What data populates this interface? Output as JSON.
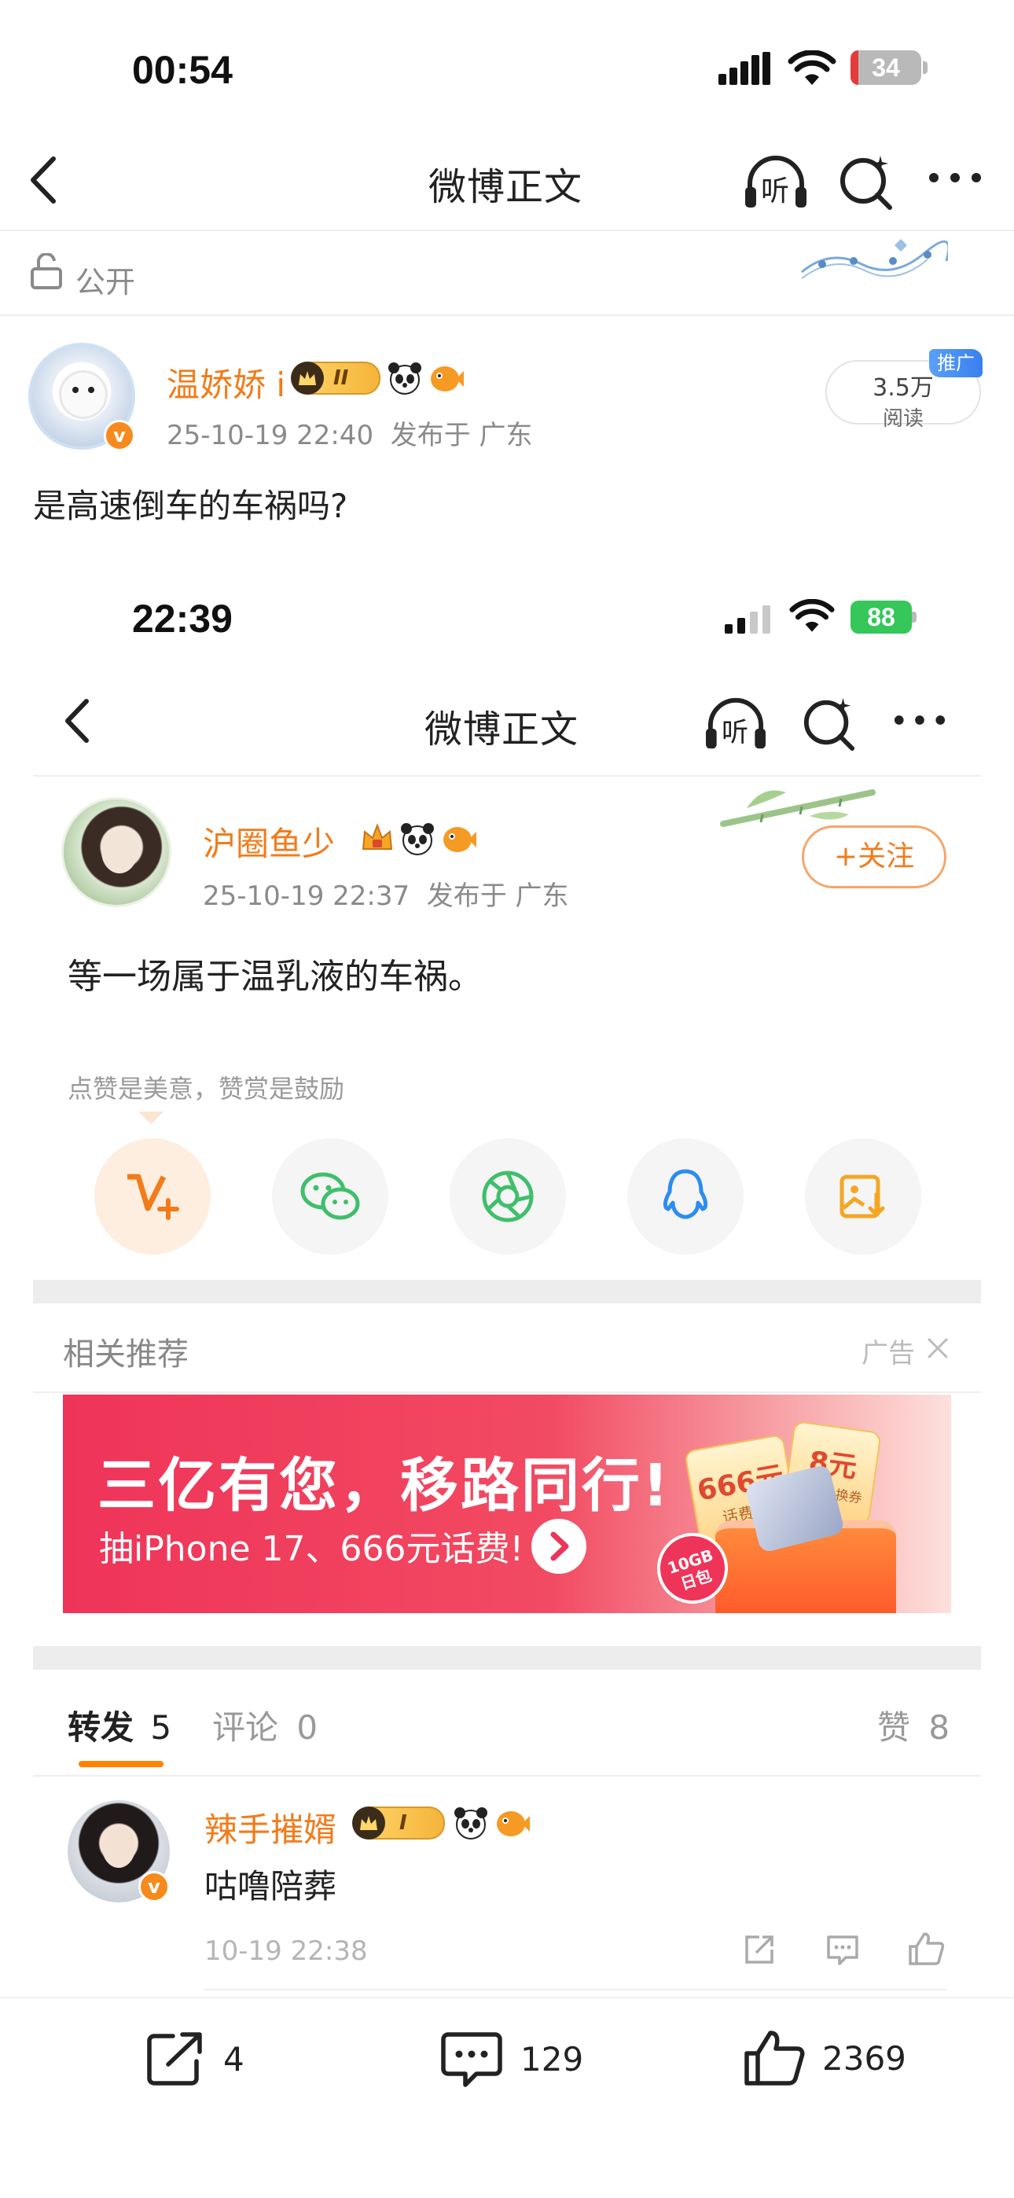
{
  "outer_status": {
    "time": "00:54",
    "battery": "34"
  },
  "outer_nav": {
    "title": "微博正文",
    "listen_label": "听"
  },
  "visibility": {
    "label": "公开"
  },
  "outer_post": {
    "username": "温娇娇 i",
    "badge_level": "II",
    "meta": "25-10-19 22:40  发布于 广东",
    "reads_count": "3.5万",
    "reads_label": "阅读",
    "promo_tag": "推广",
    "text": "是高速倒车的车祸吗?"
  },
  "inner_status": {
    "time": "22:39",
    "battery": "88"
  },
  "inner_nav": {
    "title": "微博正文",
    "listen_label": "听"
  },
  "inner_post": {
    "username": "沪圈鱼少",
    "meta": "25-10-19 22:37  发布于 广东",
    "follow_label": "+关注",
    "text": "等一场属于温乳液的车祸。",
    "tip_text": "点赞是美意，赞赏是鼓励"
  },
  "recommend": {
    "header": "相关推荐",
    "ad_label": "广告",
    "banner_title": "三亿有您，移路同行!",
    "banner_sub": "抽iPhone 17、666元话费!",
    "coupon1": "666元",
    "coupon1_sub": "话费券",
    "coupon2": "8元",
    "coupon2_sub": "话费兑换券",
    "data_tag": "10GB 日包"
  },
  "tabs": {
    "repost_label": "转发",
    "repost_count": "5",
    "comment_label": "评论",
    "comment_count": "0",
    "like_label": "赞",
    "like_count": "8"
  },
  "repost_item": {
    "username": "辣手摧婿",
    "badge_level": "I",
    "text": "咕噜陪葬",
    "time": "10-19 22:38"
  },
  "bottom_bar": {
    "repost_count": "4",
    "comment_count": "129",
    "like_count": "2369"
  },
  "colors": {
    "accent": "#f27b1a",
    "banner_red": "#ef3e5a",
    "tab_underline": "#ff8200"
  }
}
